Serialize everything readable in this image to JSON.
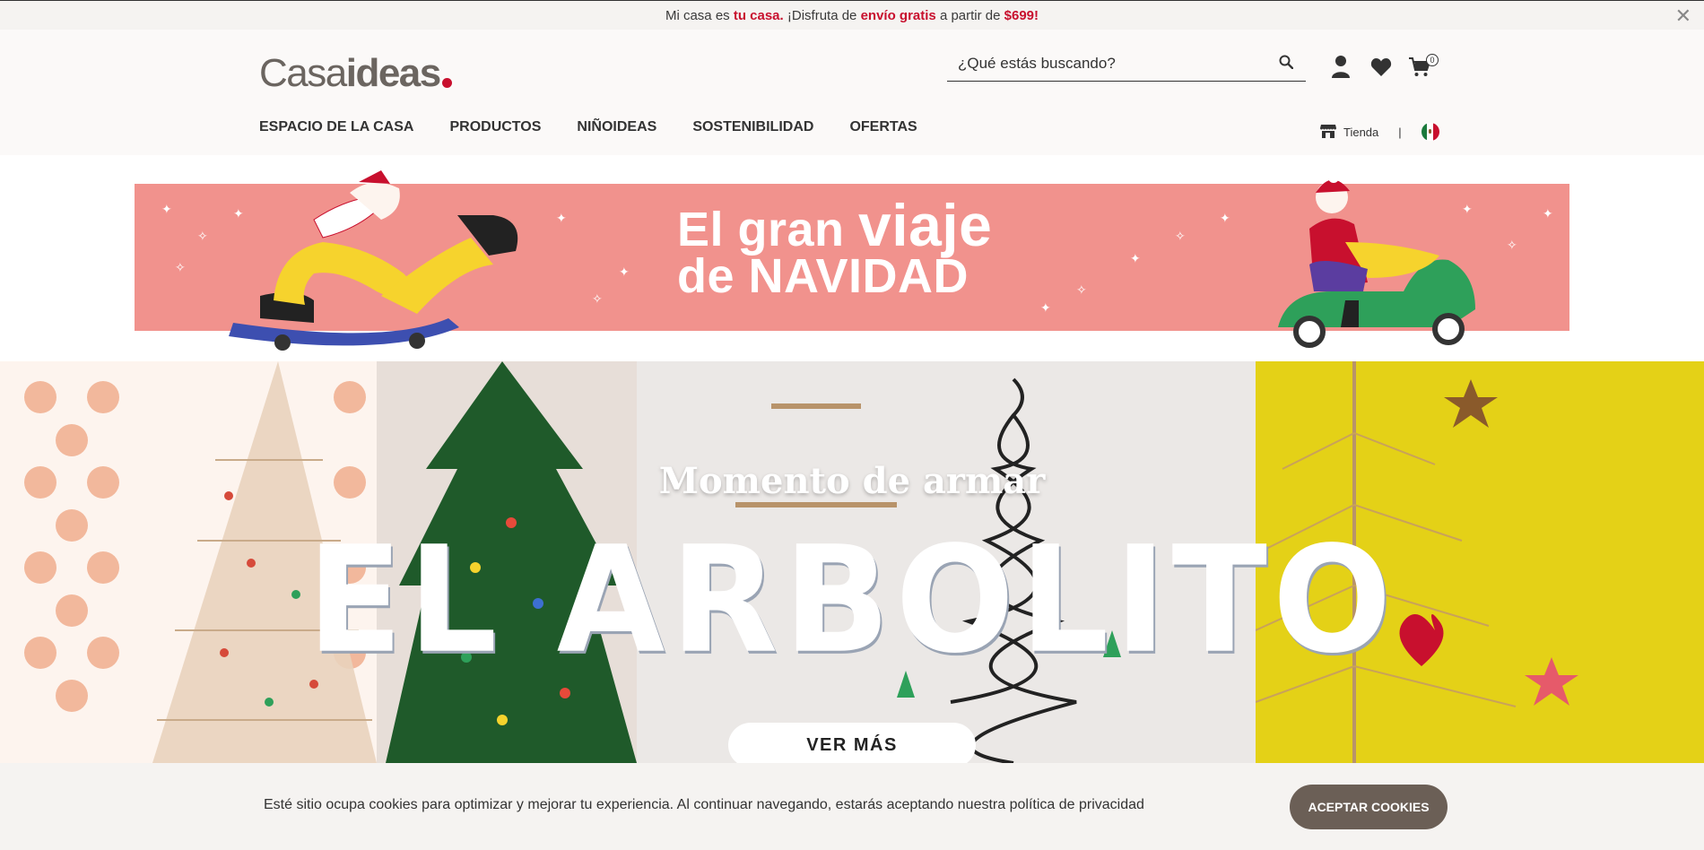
{
  "announcement": {
    "prefix": "Mi casa es ",
    "highlight1": "tu casa.",
    "middle": " ¡Disfruta de ",
    "highlight2": "envío gratis",
    "after": " a partir de ",
    "highlight3": "$699!",
    "close_icon": "close-icon"
  },
  "header": {
    "logo_light": "Casa",
    "logo_bold": "ideas",
    "search_placeholder": "¿Qué estás buscando?",
    "cart_count": "0",
    "icons": [
      "search-icon",
      "user-icon",
      "heart-icon",
      "cart-icon"
    ]
  },
  "nav": {
    "items": [
      {
        "label": "ESPACIO DE LA CASA"
      },
      {
        "label": "PRODUCTOS"
      },
      {
        "label": "NIÑOIDEAS"
      },
      {
        "label": "SOSTENIBILIDAD"
      },
      {
        "label": "OFERTAS"
      }
    ],
    "store_label": "Tienda",
    "separator": "|"
  },
  "promo_banner": {
    "line1_a": "El gran ",
    "line1_b": "viaje",
    "line2": "de NAVIDAD"
  },
  "hero": {
    "subtitle": "Momento de armar",
    "title": "EL ARBOLITO",
    "cta": "VER MÁS"
  },
  "cookie_bar": {
    "text": "Esté sitio ocupa cookies para optimizar y mejorar tu experiencia. Al continuar navegando, estarás aceptando nuestra política de privacidad",
    "button": "ACEPTAR COOKIES"
  },
  "colors": {
    "accent": "#c8102e",
    "promo_bg": "#f1928d",
    "cookie_button": "#6b5f56"
  }
}
